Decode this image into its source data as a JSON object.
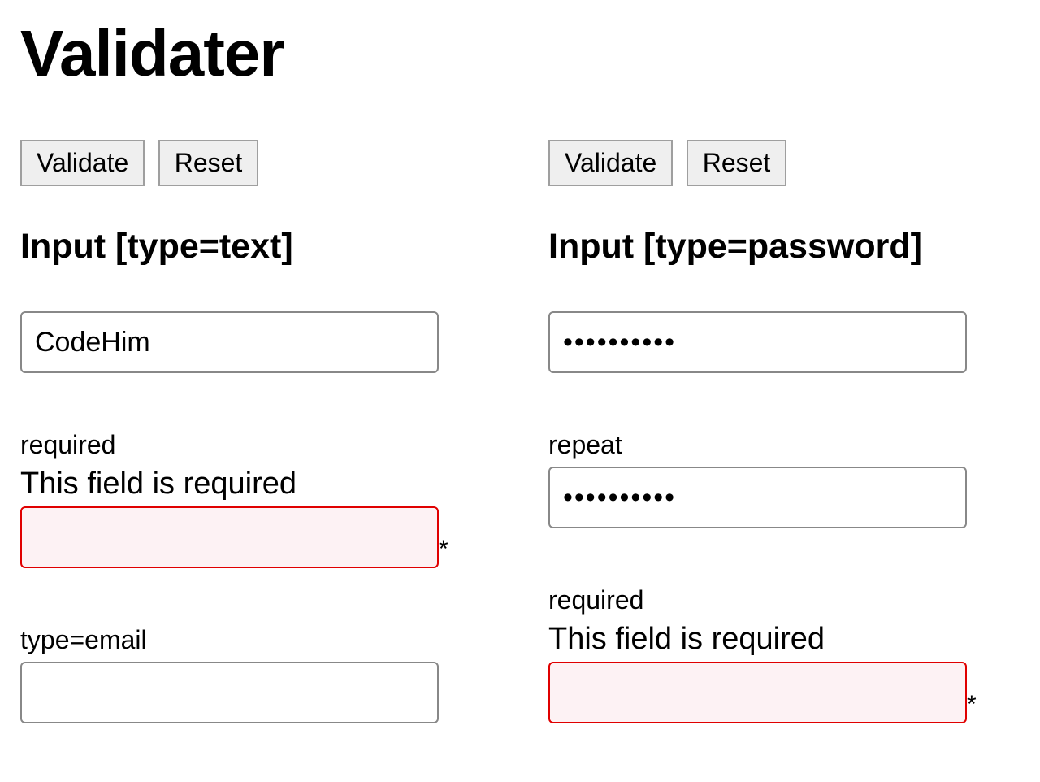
{
  "page_title": "Validater",
  "buttons": {
    "validate": "Validate",
    "reset": "Reset"
  },
  "left": {
    "heading": "Input [type=text]",
    "field1": {
      "value": "CodeHim"
    },
    "field2": {
      "label": "required",
      "error": "This field is required",
      "value": "",
      "asterisk": "*"
    },
    "field3": {
      "label": "type=email",
      "value": ""
    }
  },
  "right": {
    "heading": "Input [type=password]",
    "field1": {
      "value": "••••••••••"
    },
    "field2": {
      "label": "repeat",
      "value": "••••••••••"
    },
    "field3": {
      "label": "required",
      "error": "This field is required",
      "value": "",
      "asterisk": "*"
    }
  }
}
